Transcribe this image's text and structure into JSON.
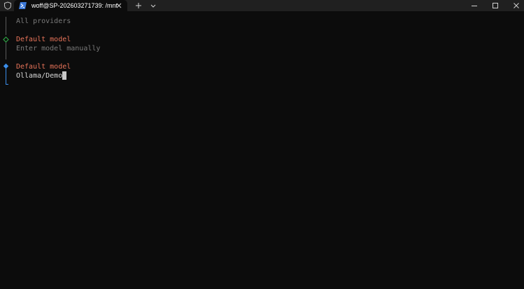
{
  "window": {
    "tab_title": "woff@SP-202603271739: /mnt",
    "icons": {
      "shield": "shield-icon",
      "tab": "powershell-icon",
      "close": "close-icon",
      "new_tab": "plus-icon",
      "dropdown": "chevron-down-icon",
      "minimize": "minimize-icon",
      "maximize": "maximize-icon",
      "window_close": "close-icon"
    }
  },
  "terminal": {
    "providers_label": "All providers",
    "step1": {
      "title": "Default model",
      "hint": "Enter model manually"
    },
    "step2": {
      "title": "Default model",
      "value": "Ollama/Demo"
    }
  },
  "colors": {
    "background": "#0c0c0c",
    "titlebar": "#202020",
    "accent": "#e8745a",
    "muted": "#7a7a7a",
    "done_marker": "#2ea043",
    "active_marker": "#3b8eea"
  }
}
